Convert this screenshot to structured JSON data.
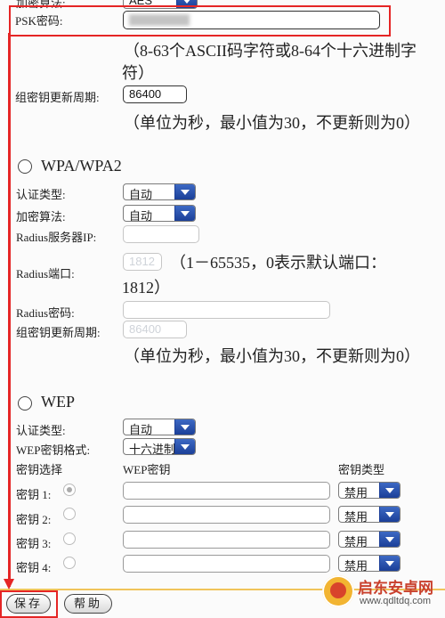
{
  "top": {
    "enc_label": "加密算法:",
    "enc_value": "AES",
    "psk_label": "PSK密码:",
    "psk_hint": "（8-63个ASCII码字符或8-64个十六进制字",
    "psk_hint2": "符）",
    "group_label": "组密钥更新周期:",
    "group_value": "86400",
    "group_hint": "（单位为秒，最小值为30，不更新则为0）"
  },
  "wpa": {
    "title": "WPA/WPA2",
    "auth_label": "认证类型:",
    "auth_value": "自动",
    "enc_label": "加密算法:",
    "enc_value": "自动",
    "radius_ip_label": "Radius服务器IP:",
    "radius_port_label": "Radius端口:",
    "radius_port_value": "1812",
    "radius_port_hint": "（1－65535，0表示默认端口：",
    "radius_port_hint2": "1812）",
    "radius_pwd_label": "Radius密码:",
    "group_label": "组密钥更新周期:",
    "group_value": "86400",
    "group_hint": "（单位为秒，最小值为30，不更新则为0）"
  },
  "wep": {
    "title": "WEP",
    "auth_label": "认证类型:",
    "auth_value": "自动",
    "format_label": "WEP密钥格式:",
    "format_value": "十六进制",
    "col_select": "密钥选择",
    "col_key": "WEP密钥",
    "col_type": "密钥类型",
    "keys": [
      {
        "label": "密钥 1:",
        "type": "禁用"
      },
      {
        "label": "密钥 2:",
        "type": "禁用"
      },
      {
        "label": "密钥 3:",
        "type": "禁用"
      },
      {
        "label": "密钥 4:",
        "type": "禁用"
      }
    ]
  },
  "buttons": {
    "save": "保存",
    "help": "帮助"
  },
  "watermark": {
    "site": "启东安卓网",
    "url": "www.qdltdq.com"
  },
  "colors": {
    "highlight": "#e52525",
    "select_arrow": "#1b3f98",
    "divider": "#f0c45a"
  }
}
